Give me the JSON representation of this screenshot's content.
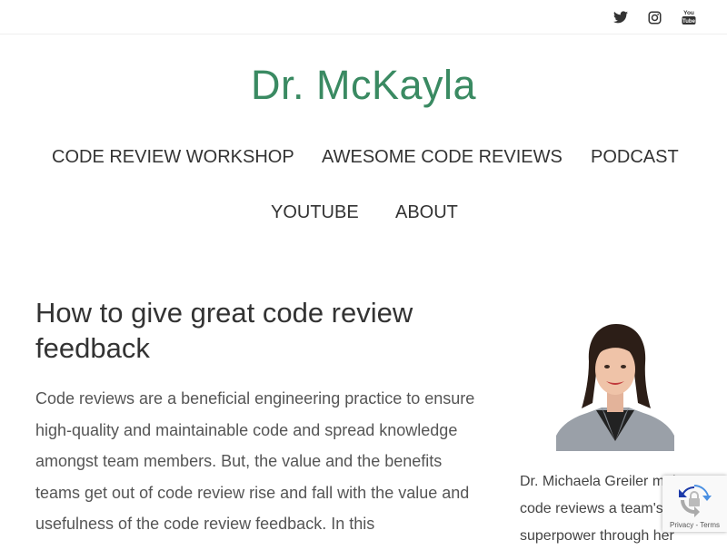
{
  "topbar": {
    "social": [
      {
        "name": "twitter-icon"
      },
      {
        "name": "instagram-icon"
      },
      {
        "name": "youtube-icon",
        "label_top": "You",
        "label_bottom": "Tube"
      }
    ]
  },
  "header": {
    "site_title": "Dr. McKayla"
  },
  "nav": {
    "items": [
      {
        "label": "CODE REVIEW WORKSHOP"
      },
      {
        "label": "AWESOME CODE REVIEWS"
      },
      {
        "label": "PODCAST"
      },
      {
        "label": "YOUTUBE"
      },
      {
        "label": "ABOUT"
      }
    ]
  },
  "article": {
    "title": "How to give great code review feedback",
    "body": "Code reviews are a beneficial engineering practice to ensure high-quality and maintainable code and spread knowledge amongst team members. But, the value and the benefits teams get out of code review rise and fall with the value and usefulness of the code review feedback. In this"
  },
  "sidebar": {
    "photo_alt": "Dr. Michaela Greiler portrait",
    "bio": "Dr. Michaela Greiler makes code reviews a team's superpower through her"
  },
  "recaptcha": {
    "privacy": "Privacy",
    "separator": " - ",
    "terms": "Terms"
  },
  "colors": {
    "brand_green": "#3a8a62",
    "text": "#333333"
  }
}
